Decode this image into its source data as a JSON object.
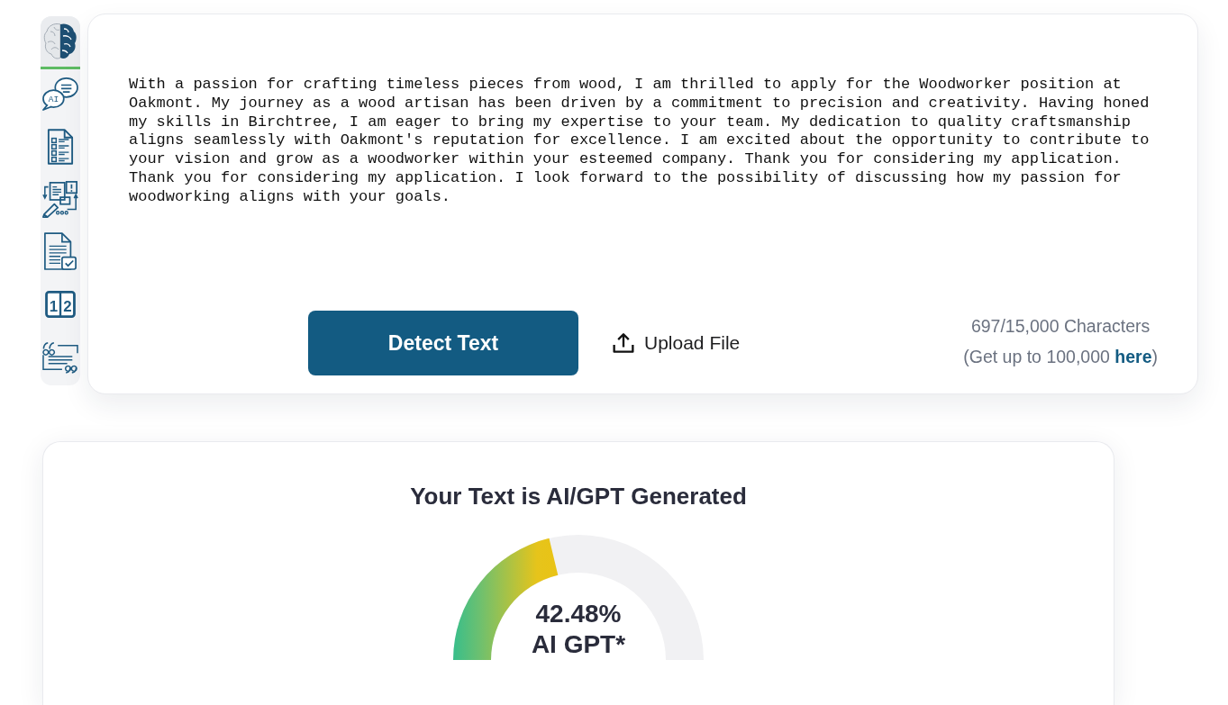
{
  "sidebar": {
    "items": [
      {
        "selected": true
      },
      {
        "selected": false,
        "icon_text": "AI"
      },
      {
        "selected": false
      },
      {
        "selected": false
      },
      {
        "selected": false
      },
      {
        "selected": false,
        "icon_digits": [
          "1",
          "2"
        ]
      },
      {
        "selected": false
      }
    ]
  },
  "editor": {
    "text": "With a passion for crafting timeless pieces from wood, I am thrilled to apply for the Woodworker position at Oakmont. My journey as a wood artisan has been driven by a commitment to precision and creativity. Having honed my skills in Birchtree, I am eager to bring my expertise to your team. My dedication to quality craftsmanship aligns seamlessly with Oakmont's reputation for excellence. I am excited about the opportunity to contribute to your vision and grow as a woodworker within your esteemed company. Thank you for considering my application. Thank you for considering my application. I look forward to the possibility of discussing how my passion for woodworking aligns with your goals."
  },
  "actions": {
    "detect_button": "Detect Text",
    "upload_button": "Upload File"
  },
  "counter": {
    "count": "697/15,000 Characters",
    "upgrade_before": "(Get up to 100,000 ",
    "upgrade_link": "here",
    "upgrade_after": ")"
  },
  "result": {
    "title": "Your Text is AI/GPT Generated",
    "gauge": {
      "level": 0.4248,
      "reading": "42.48%",
      "label": "AI GPT*"
    }
  }
}
